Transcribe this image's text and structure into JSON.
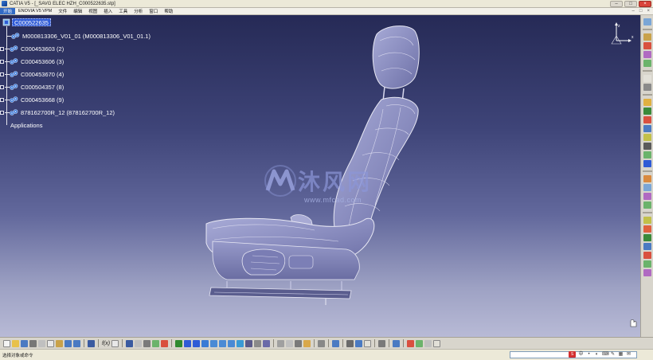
{
  "window": {
    "title": "CATIA V5 - [_SAVG ELEC HZH_C000522635.stp]",
    "minimize": "–",
    "maximize": "□",
    "close": "×"
  },
  "menu": {
    "items": [
      "开始",
      "ENOVIA V5 VPM",
      "文件",
      "编辑",
      "视图",
      "插入",
      "工具",
      "分析",
      "窗口",
      "帮助"
    ],
    "right": [
      "–",
      "□",
      "×"
    ]
  },
  "tree": {
    "root": "C000522635",
    "children": [
      "M000813306_V01_01 (M000813306_V01_01.1)",
      "C000453603 (2)",
      "C000453606 (3)",
      "C000453670 (4)",
      "C000504357 (8)",
      "C000453668 (9)",
      "878162700R_12 (878162700R_12)"
    ],
    "applications": "Applications"
  },
  "compass": {
    "z": "z",
    "x": "x"
  },
  "watermark": {
    "cn": "沐风网",
    "url": "www.mfcad.com"
  },
  "toolbar": {
    "fx_label": "f(x)"
  },
  "status": {
    "message": "选择对象或命令",
    "ime": [
      "S",
      "中",
      "•",
      "◐",
      "⌨",
      "✎",
      "▦",
      "✉"
    ]
  },
  "colors": {
    "background_top": "#262a56",
    "background_bottom": "#b8bad6",
    "selection": "#2f5bd6",
    "tree_text": "#ffffff",
    "seat_fill": "#8b8ec0"
  }
}
